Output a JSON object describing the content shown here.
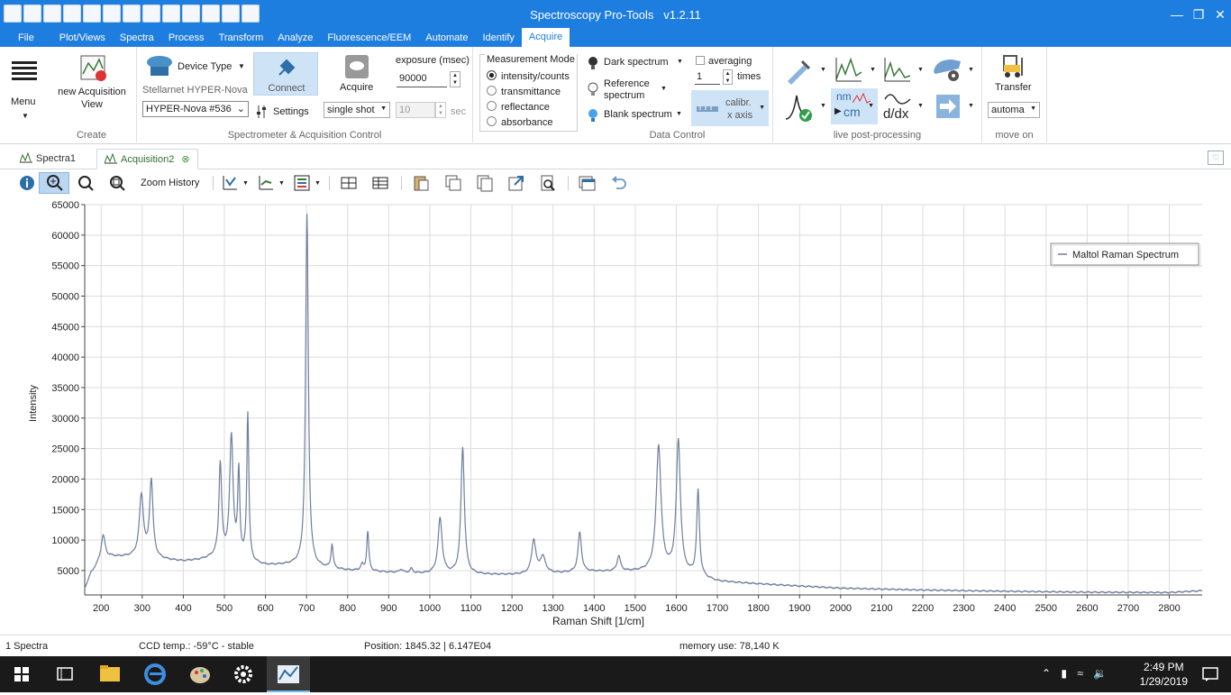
{
  "window": {
    "title": "Spectroscopy Pro-Tools",
    "version": "v1.2.11"
  },
  "menu": [
    "File",
    "Plot/Views",
    "Spectra",
    "Process",
    "Transform",
    "Analyze",
    "Fluorescence/EEM",
    "Automate",
    "Identify",
    "Acquire"
  ],
  "ribbon": {
    "menu_label": "Menu",
    "create": {
      "new_view": "new Acquisition View",
      "group": "Create"
    },
    "spectrometer": {
      "device_type": "Device Type",
      "device_name": "Stellarnet HYPER-Nova",
      "device_select": "HYPER-Nova #536",
      "connect": "Connect",
      "acquire": "Acquire",
      "settings": "Settings",
      "exposure_label": "exposure (msec)",
      "exposure_value": "90000",
      "shot_mode": "single shot",
      "count_value": "10",
      "sec": "sec",
      "group": "Spectrometer & Acquisition Control"
    },
    "measurement": {
      "title": "Measurement Mode",
      "options": [
        "intensity/counts",
        "transmittance",
        "reflectance",
        "absorbance"
      ],
      "selected": "intensity/counts"
    },
    "data_control": {
      "dark": "Dark spectrum",
      "reference": "Reference spectrum",
      "blank": "Blank spectrum",
      "averaging": "averaging",
      "avg_value": "1",
      "times": "times",
      "calibr": "calibr.",
      "x_axis": "x axis",
      "group": "Data Control"
    },
    "post": {
      "group": "live post-processing",
      "deriv": "d/dx",
      "nm": "nm",
      "cm": "cm"
    },
    "move_on": {
      "transfer": "Transfer",
      "auto": "automa",
      "group": "move on"
    }
  },
  "tabs": [
    {
      "label": "Spectra1"
    },
    {
      "label": "Acquisition2"
    }
  ],
  "plot_toolbar": {
    "zoom_history": "Zoom History"
  },
  "chart_data": {
    "type": "line",
    "xlabel": "Raman Shift [1/cm]",
    "ylabel": "Intensity",
    "xlim": [
      160,
      2880
    ],
    "ylim": [
      1000,
      65000
    ],
    "xticks": [
      200,
      300,
      400,
      500,
      600,
      700,
      800,
      900,
      1000,
      1100,
      1200,
      1300,
      1400,
      1500,
      1600,
      1700,
      1800,
      1900,
      2000,
      2100,
      2200,
      2300,
      2400,
      2500,
      2600,
      2700,
      2800
    ],
    "yticks": [
      5000,
      10000,
      15000,
      20000,
      25000,
      30000,
      35000,
      40000,
      45000,
      50000,
      55000,
      60000,
      65000
    ],
    "grid": true,
    "legend_position": "top-right",
    "line_color": "#6e7f9e",
    "series": [
      {
        "name": "Maltol Raman Spectrum",
        "baseline": [
          [
            160,
            2000
          ],
          [
            175,
            4500
          ],
          [
            195,
            6200
          ],
          [
            225,
            7200
          ],
          [
            300,
            7200
          ],
          [
            340,
            6800
          ],
          [
            400,
            6500
          ],
          [
            440,
            6700
          ],
          [
            480,
            7200
          ],
          [
            520,
            7000
          ],
          [
            560,
            6200
          ],
          [
            600,
            5800
          ],
          [
            680,
            5900
          ],
          [
            720,
            5500
          ],
          [
            800,
            5000
          ],
          [
            900,
            4700
          ],
          [
            1000,
            4400
          ],
          [
            1100,
            4300
          ],
          [
            1200,
            4300
          ],
          [
            1300,
            4500
          ],
          [
            1400,
            4800
          ],
          [
            1500,
            4800
          ],
          [
            1600,
            4700
          ],
          [
            1660,
            3800
          ],
          [
            1700,
            3200
          ],
          [
            1800,
            2800
          ],
          [
            2000,
            2100
          ],
          [
            2200,
            1800
          ],
          [
            2400,
            1600
          ],
          [
            2600,
            1450
          ],
          [
            2800,
            1400
          ],
          [
            2880,
            1700
          ]
        ],
        "peaks": [
          [
            205,
            4200,
            6
          ],
          [
            298,
            10000,
            6
          ],
          [
            322,
            12600,
            5
          ],
          [
            490,
            15200,
            4
          ],
          [
            517,
            19800,
            5
          ],
          [
            535,
            14000,
            3
          ],
          [
            557,
            24300,
            3
          ],
          [
            701,
            57700,
            4
          ],
          [
            762,
            3900,
            3
          ],
          [
            835,
            1000,
            4
          ],
          [
            849,
            6500,
            3
          ],
          [
            930,
            500,
            5
          ],
          [
            955,
            700,
            4
          ],
          [
            1025,
            9100,
            6
          ],
          [
            1080,
            20800,
            5
          ],
          [
            1253,
            5500,
            6
          ],
          [
            1275,
            2700,
            8
          ],
          [
            1365,
            6500,
            5
          ],
          [
            1460,
            2500,
            5
          ],
          [
            1557,
            20600,
            7
          ],
          [
            1605,
            21500,
            6
          ],
          [
            1653,
            14000,
            4
          ]
        ]
      }
    ]
  },
  "status": {
    "count": "1 Spectra",
    "ccd": "CCD temp.: -59°C - stable",
    "position": "Position: 1845.32 | 6.147E04",
    "memory": "memory use: 78,140 K"
  },
  "taskbar": {
    "time": "2:49 PM",
    "date": "1/29/2019"
  }
}
